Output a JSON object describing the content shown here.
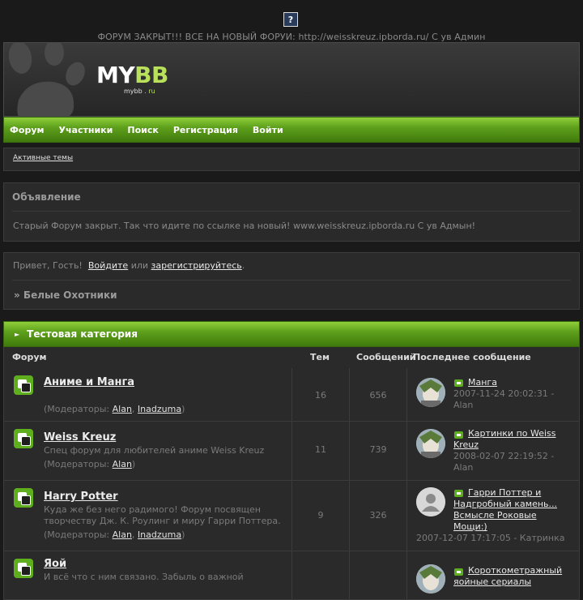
{
  "notice": "ФОРУМ ЗАКРЫТ!!! ВСЕ НА НОВЫЙ ФОРУИ: http://weisskreuz.ipborda.ru/ С ув Админ",
  "top_icon": "?",
  "logo": {
    "my": "MY",
    "bb": "BB",
    "sub_name": "mybb",
    "sub_dot": " . ",
    "sub_ru": "ru"
  },
  "nav": [
    "Форум",
    "Участники",
    "Поиск",
    "Регистрация",
    "Войти"
  ],
  "active_topics": "Активные темы",
  "announcement": {
    "title": "Объявление",
    "text": "Старый Форум закрыт. Так что идите по ссылке на новый! www.weisskreuz.ipborda.ru С ув Адмын!"
  },
  "welcome": {
    "greeting": "Привет, Гость!",
    "login": "Войдите",
    "or": "или",
    "register": "зарегистрируйтесь",
    "dot": ".",
    "breadcrumb": "» Белые Охотники"
  },
  "category": {
    "title": "Тестовая категория",
    "columns": {
      "forum": "Форум",
      "topics": "Тем",
      "posts": "Сообщений",
      "last": "Последнее сообщение"
    }
  },
  "mods_label": "(Модераторы:",
  "forums": [
    {
      "name": "Аниме и Манга",
      "desc": "",
      "mods": [
        "Alan",
        "Inadzuma"
      ],
      "topics": "16",
      "posts": "656",
      "last_title": "Манга",
      "last_date": "2007-11-24 20:02:31 -",
      "last_author": "Alan"
    },
    {
      "name": "Weiss Kreuz",
      "desc": "Спец форум для любителей аниме Weiss Kreuz",
      "mods": [
        "Alan"
      ],
      "topics": "11",
      "posts": "739",
      "last_title_1": "Картинки по Weiss",
      "last_title_2": "Kreuz",
      "last_date": "2008-02-07 22:19:52 -",
      "last_author": "Alan"
    },
    {
      "name": "Harry Potter",
      "desc_1": "Куда же без него радимого! Форум посвящен",
      "desc_2": "творчеству Дж. К. Роулинг и миру Гарри Поттера.",
      "mods": [
        "Alan",
        "Inadzuma"
      ],
      "topics": "9",
      "posts": "326",
      "last_title_1": "Гарри Поттер и",
      "last_title_2": "Надгробный камень...",
      "last_title_3": "Всмысле Роковые",
      "last_title_4": "Мощи:)",
      "last_meta": "2007-12-07 17:17:05 - Катринка"
    },
    {
      "name": "Яой",
      "desc_1": "И всё что с ним связано. Забыль о важной",
      "last_title_1": "Короткометражный",
      "last_title_2": "яойные сериалы"
    }
  ]
}
